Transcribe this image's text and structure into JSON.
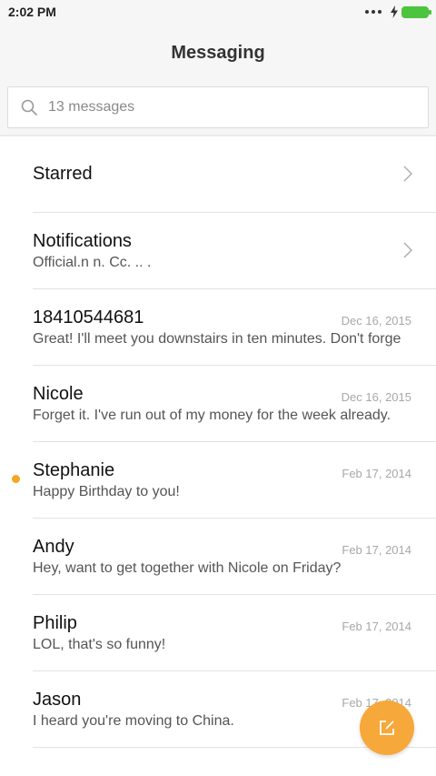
{
  "status": {
    "time": "2:02 PM",
    "icons": [
      "overflow-dots-icon",
      "charging-bolt-icon",
      "battery-icon"
    ],
    "battery_color": "#4cc43d"
  },
  "appbar": {
    "title": "Messaging"
  },
  "search": {
    "placeholder": "13 messages"
  },
  "threads": [
    {
      "title": "Starred",
      "chevron": true
    },
    {
      "title": "Notifications",
      "subtitle": "Official.n n.  Cc. ..   .",
      "chevron": true
    },
    {
      "title": "18410544681",
      "subtitle": "Great! I'll meet you downstairs in ten minutes. Don't forge",
      "date": "Dec 16, 2015"
    },
    {
      "title": "Nicole",
      "subtitle": "Forget it. I've run out of my money for the week already.",
      "date": "Dec 16, 2015"
    },
    {
      "title": "Stephanie",
      "subtitle": "Happy Birthday to you!",
      "date": "Feb 17, 2014",
      "unread": true
    },
    {
      "title": "Andy",
      "subtitle": "Hey, want to get together with Nicole on Friday?",
      "date": "Feb 17, 2014"
    },
    {
      "title": "Philip",
      "subtitle": "LOL, that's so funny!",
      "date": "Feb 17, 2014"
    },
    {
      "title": "Jason",
      "subtitle": "I heard you're moving to China.",
      "date": "Feb 17, 2014"
    }
  ],
  "fab": {
    "icon": "compose-icon",
    "color": "#f6a83a"
  },
  "colors": {
    "unread_dot": "#f5a623",
    "date_text": "#a8a8a8",
    "header_bg": "#f6f6f6"
  }
}
